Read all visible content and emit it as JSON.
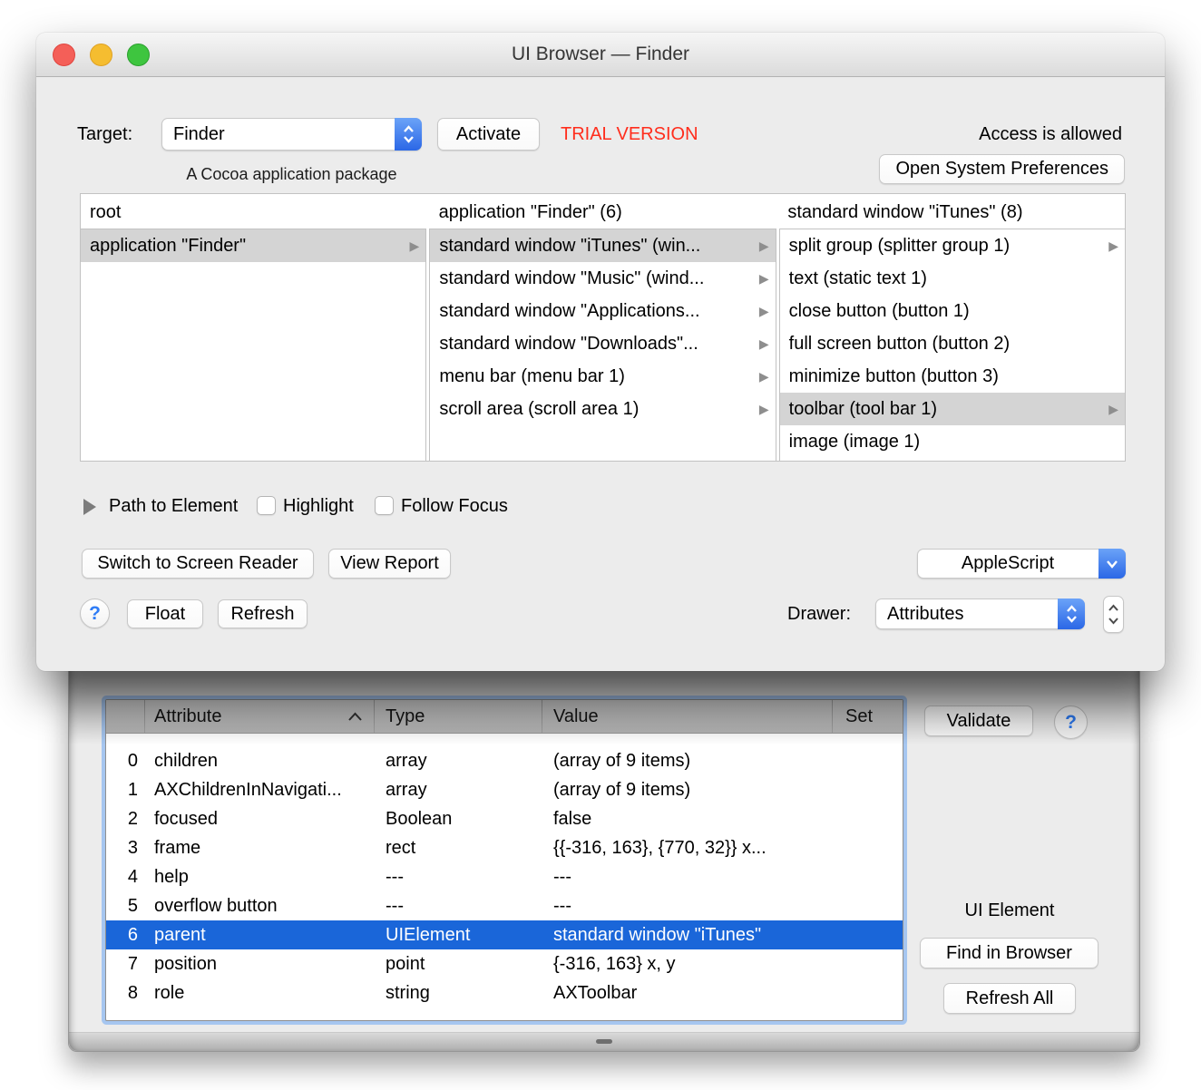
{
  "colors": {
    "selection_blue": "#1a66d9",
    "popup_blue": "#2b67e6",
    "trial_red": "#ff2d1c",
    "list_selection_gray": "#d4d4d4"
  },
  "win": {
    "title": "UI Browser — Finder"
  },
  "target": {
    "label": "Target:",
    "value": "Finder",
    "description": "A Cocoa application package",
    "activate": "Activate",
    "trial": "TRIAL VERSION",
    "access": "Access is allowed",
    "open_prefs": "Open System Preferences"
  },
  "browser": {
    "columns": [
      {
        "header": "root",
        "items": [
          {
            "label": "application \"Finder\"",
            "selected": true,
            "arrow": true
          }
        ]
      },
      {
        "header": "application \"Finder\" (6)",
        "items": [
          {
            "label": "standard window \"iTunes\" (win...",
            "selected": true,
            "arrow": true
          },
          {
            "label": "standard window \"Music\" (wind...",
            "arrow": true
          },
          {
            "label": "standard window \"Applications...",
            "arrow": true
          },
          {
            "label": "standard window \"Downloads\"...",
            "arrow": true
          },
          {
            "label": "menu bar (menu bar 1)",
            "arrow": true
          },
          {
            "label": "scroll area (scroll area 1)",
            "arrow": true
          }
        ]
      },
      {
        "header": "standard window \"iTunes\" (8)",
        "items": [
          {
            "label": "split group (splitter group 1)",
            "arrow": true
          },
          {
            "label": "text (static text 1)"
          },
          {
            "label": "close button (button 1)"
          },
          {
            "label": "full screen button (button 2)"
          },
          {
            "label": "minimize button (button 3)"
          },
          {
            "label": "toolbar (tool bar 1)",
            "selected": true,
            "arrow": true
          },
          {
            "label": "image (image 1)"
          }
        ]
      }
    ]
  },
  "controls": {
    "path_to_element": "Path to Element",
    "highlight": "Highlight",
    "follow_focus": "Follow Focus",
    "switch_to_screen_reader": "Switch to Screen Reader",
    "view_report": "View Report",
    "applescript": "AppleScript",
    "help": "?",
    "float": "Float",
    "refresh": "Refresh",
    "drawer_label": "Drawer:",
    "drawer_value": "Attributes"
  },
  "drawer": {
    "table": {
      "headers": [
        "Attribute",
        "Type",
        "Value",
        "Set"
      ],
      "sort": "ascending",
      "rows": [
        {
          "index": "0",
          "attribute": "children",
          "type": "array",
          "value": "(array of 9 items)"
        },
        {
          "index": "1",
          "attribute": "AXChildrenInNavigati...",
          "type": "array",
          "value": "(array of 9 items)"
        },
        {
          "index": "2",
          "attribute": "focused",
          "type": "Boolean",
          "value": "false"
        },
        {
          "index": "3",
          "attribute": "frame",
          "type": "rect",
          "value": "{{-316, 163}, {770, 32}} x..."
        },
        {
          "index": "4",
          "attribute": "help",
          "type": "---",
          "value": "---"
        },
        {
          "index": "5",
          "attribute": "overflow button",
          "type": "---",
          "value": "---"
        },
        {
          "index": "6",
          "attribute": "parent",
          "type": "UIElement",
          "value": "standard window \"iTunes\"",
          "selected": true
        },
        {
          "index": "7",
          "attribute": "position",
          "type": "point",
          "value": "{-316, 163} x, y"
        },
        {
          "index": "8",
          "attribute": "role",
          "type": "string",
          "value": "AXToolbar"
        }
      ]
    },
    "validate": "Validate",
    "help": "?",
    "ui_element": "UI Element",
    "find_in_browser": "Find in Browser",
    "refresh_all": "Refresh All"
  }
}
